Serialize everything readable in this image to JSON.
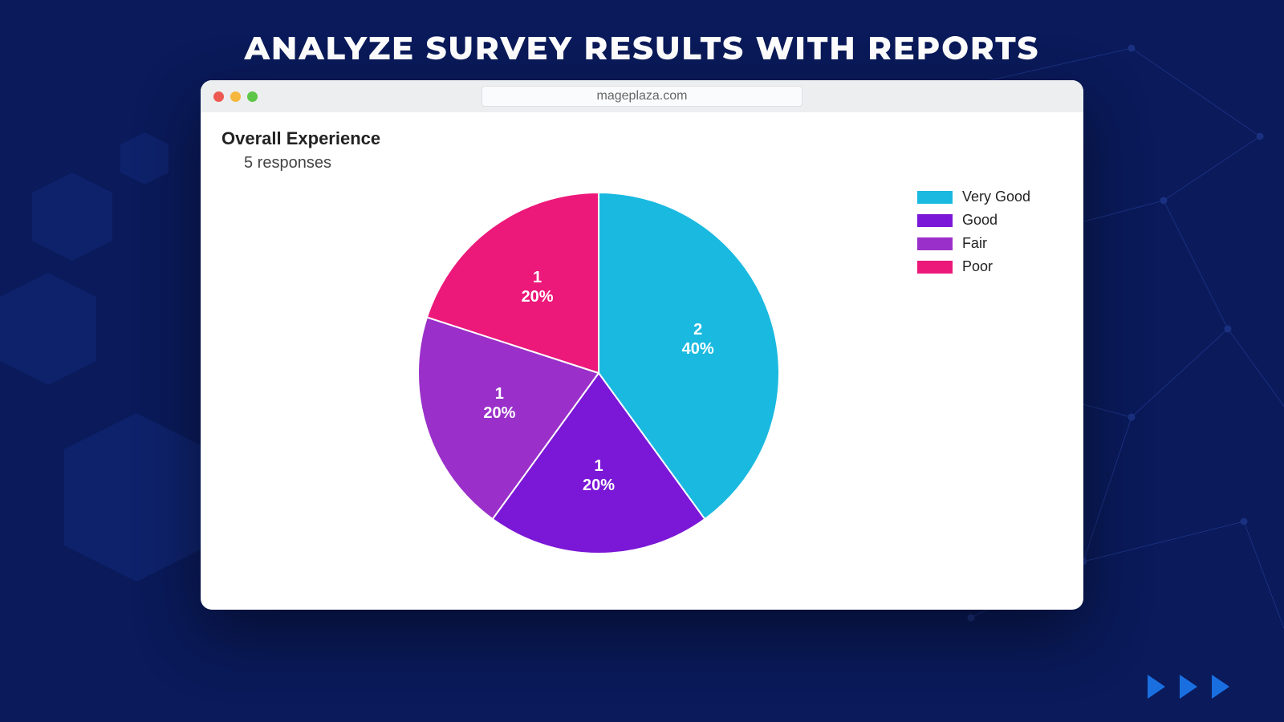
{
  "page": {
    "title": "ANALYZE SURVEY RESULTS WITH REPORTS"
  },
  "browser": {
    "url": "mageplaza.com"
  },
  "chart": {
    "title": "Overall Experience",
    "subtitle": "5 responses"
  },
  "chart_data": {
    "type": "pie",
    "title": "Overall Experience",
    "total_responses": 5,
    "series": [
      {
        "name": "Very Good",
        "value": 2,
        "percent": 40,
        "color": "#1ab9e0"
      },
      {
        "name": "Good",
        "value": 1,
        "percent": 20,
        "color": "#7b17d6"
      },
      {
        "name": "Fair",
        "value": 1,
        "percent": 20,
        "color": "#9a30c9"
      },
      {
        "name": "Poor",
        "value": 1,
        "percent": 20,
        "color": "#ec187a"
      }
    ],
    "legend_position": "right"
  }
}
